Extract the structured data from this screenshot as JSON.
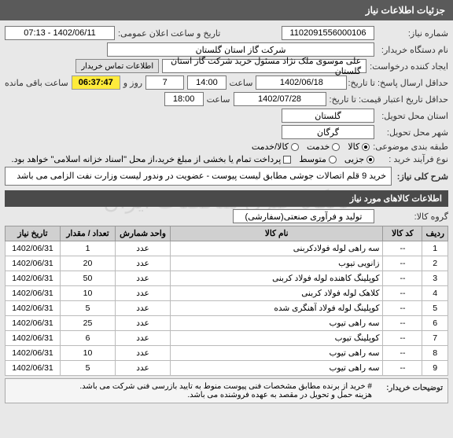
{
  "header": {
    "title": "جزئیات اطلاعات نیاز"
  },
  "top": {
    "need_no_label": "شماره نیاز:",
    "need_no": "1102091556000106",
    "announce_label": "تاریخ و ساعت اعلان عمومی:",
    "announce_value": "1402/06/11 - 07:13",
    "buyer_label": "نام دستگاه خریدار:",
    "buyer_value": "شرکت گاز استان گلستان",
    "creator_label": "ایجاد کننده درخواست:",
    "creator_value": "علی موسوی ملک نژاد مسئول خرید شرکت گاز استان گلستان",
    "contact_btn": "اطلاعات تماس خریدار",
    "deadline_label": "حداقل ارسال پاسخ: تا تاریخ:",
    "deadline_date": "1402/06/18",
    "time_lbl": "ساعت",
    "deadline_time": "14:00",
    "days": "7",
    "days_lbl": "روز و",
    "timer": "06:37:47",
    "remain_lbl": "ساعت باقی مانده",
    "valid_label": "حداقل تاریخ اعتبار قیمت: تا تاریخ:",
    "valid_date": "1402/07/28",
    "valid_time": "18:00",
    "province_label": "استان محل تحویل:",
    "province_value": "گلستان",
    "city_label": "شهر محل تحویل:",
    "city_value": "گرگان",
    "category_label": "طبقه بندی موضوعی:",
    "radio_goods": "کالا",
    "radio_service": "خدمت",
    "radio_both": "کالا/خدمت",
    "buy_type_label": "نوع فرآیند خرید :",
    "opt_minor": "جزیی",
    "opt_medium": "متوسط",
    "payment_note": "پرداخت تمام یا بخشی از مبلغ خرید،از محل \"اسناد خزانه اسلامی\" خواهد بود."
  },
  "desc": {
    "label": "شرح کلی نیاز:",
    "text": "خرید 9 قلم اتصالات جوشی مطابق لیست پیوست - عضویت در وندور لیست وزارت نفت الزامی می باشد"
  },
  "items": {
    "section": "اطلاعات کالاهای مورد نیاز",
    "group_label": "گروه کالا:",
    "group_value": "تولید و فرآوری صنعتی(سفارشی)",
    "cols": {
      "row": "ردیف",
      "code": "کد کالا",
      "name": "نام کالا",
      "unit": "واحد شمارش",
      "qty": "تعداد / مقدار",
      "date": "تاریخ نیاز"
    },
    "rows": [
      {
        "r": "1",
        "code": "--",
        "name": "سه راهی لوله فولادکربنی",
        "unit": "عدد",
        "qty": "1",
        "date": "1402/06/31"
      },
      {
        "r": "2",
        "code": "--",
        "name": "زانویی تیوب",
        "unit": "عدد",
        "qty": "20",
        "date": "1402/06/31"
      },
      {
        "r": "3",
        "code": "--",
        "name": "کوپلینگ کاهنده لوله فولاد کربنی",
        "unit": "عدد",
        "qty": "50",
        "date": "1402/06/31"
      },
      {
        "r": "4",
        "code": "--",
        "name": "کلاهک لوله فولاد کربنی",
        "unit": "عدد",
        "qty": "10",
        "date": "1402/06/31"
      },
      {
        "r": "5",
        "code": "--",
        "name": "کوپلینگ لوله فولاد آهنگری شده",
        "unit": "عدد",
        "qty": "5",
        "date": "1402/06/31"
      },
      {
        "r": "6",
        "code": "--",
        "name": "سه راهی تیوب",
        "unit": "عدد",
        "qty": "25",
        "date": "1402/06/31"
      },
      {
        "r": "7",
        "code": "--",
        "name": "کوپلینگ تیوب",
        "unit": "عدد",
        "qty": "6",
        "date": "1402/06/31"
      },
      {
        "r": "8",
        "code": "--",
        "name": "سه راهی تیوب",
        "unit": "عدد",
        "qty": "10",
        "date": "1402/06/31"
      },
      {
        "r": "9",
        "code": "--",
        "name": "سه راهی تیوب",
        "unit": "عدد",
        "qty": "5",
        "date": "1402/06/31"
      }
    ]
  },
  "footer": {
    "label": "توضیحات خریدار:",
    "line1": "# خرید از برنده مطابق مشخصات فنی پیوست منوط به تایید بازرسی فنی شرکت می باشد.",
    "line2": "هزینه حمل و تحویل در مقصد به عهده فروشنده می باشد."
  }
}
